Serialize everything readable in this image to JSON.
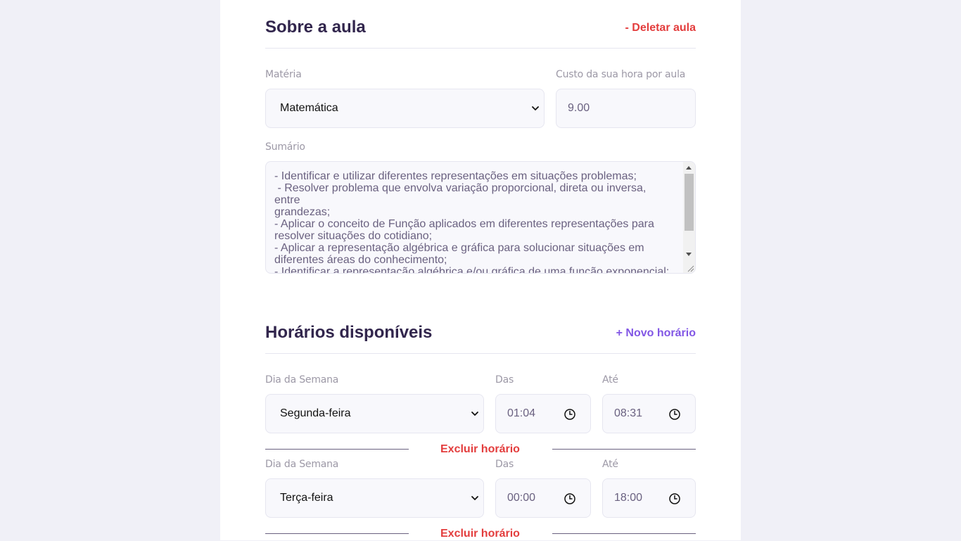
{
  "about": {
    "title": "Sobre a aula",
    "delete_label": "- Deletar aula",
    "subject_label": "Matéria",
    "subject_value": "Matemática",
    "cost_label": "Custo da sua hora por aula",
    "cost_value": "9.00",
    "summary_label": "Sumário",
    "summary_value": "- Identificar e utilizar diferentes representações em situações problemas;\n - Resolver problema que envolva variação proporcional, direta ou inversa,\nentre\ngrandezas;\n- Aplicar o conceito de Função aplicados em diferentes representações para\nresolver situações do cotidiano;\n- Aplicar a representação algébrica e gráfica para solucionar situações em\ndiferentes áreas do conhecimento;\n- Identificar a representação algébrica e/ou gráfica de uma função exponencial;"
  },
  "schedule": {
    "title": "Horários disponíveis",
    "new_label": "+ Novo horário",
    "items": [
      {
        "day_label": "Dia da Semana",
        "day_value": "Segunda-feira",
        "from_label": "Das",
        "from_value": "01:04",
        "to_label": "Até",
        "to_value": "08:31",
        "delete_label": "Excluir horário"
      },
      {
        "day_label": "Dia da Semana",
        "day_value": "Terça-feira",
        "from_label": "Das",
        "from_value": "00:00",
        "to_label": "Até",
        "to_value": "18:00",
        "delete_label": "Excluir horário"
      }
    ]
  },
  "colors": {
    "title": "#32264d",
    "danger": "#e33d3d",
    "primary": "#8257e5",
    "field_bg": "#f8f8fc",
    "page_bg": "#f0f0f7"
  },
  "icons": [
    "chevron-down-icon",
    "clock-icon",
    "resize-grip-icon"
  ]
}
